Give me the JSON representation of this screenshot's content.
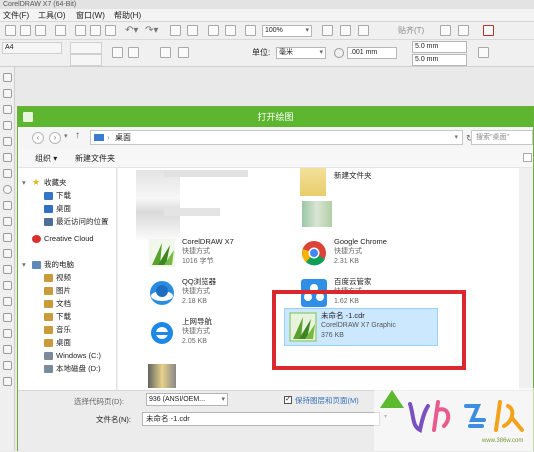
{
  "app": {
    "title": "CorelDRAW X7 (64-Bit)",
    "menu": [
      "文件(F)",
      "工具(O)",
      "窗口(W)",
      "帮助(H)"
    ],
    "zoom": "100%",
    "align_label": "贴齐(T)",
    "paper_size": "A4",
    "unit_label": "单位:",
    "unit_value": "毫米",
    "nudge_value": ".001 mm",
    "dup_x": "5.0 mm",
    "dup_y": "5.0 mm"
  },
  "dialog": {
    "title": "打开绘图",
    "path": "桌面",
    "search_placeholder": "搜索\"桌面\"",
    "organize_label": "组织 ▾",
    "new_folder_label": "新建文件夹",
    "nav": {
      "favorites": "收藏夹",
      "items_fav": [
        "下载",
        "桌面",
        "最近访问的位置"
      ],
      "creative_cloud": "Creative Cloud",
      "computer": "我的电脑",
      "items_pc": [
        "视频",
        "图片",
        "文档",
        "下载",
        "音乐",
        "桌面",
        "Windows (C:)",
        "本地磁盘 (D:)"
      ]
    },
    "files": [
      {
        "name": "新建文件夹",
        "type": "",
        "size": ""
      },
      {
        "name": "CorelDRAW X7",
        "type": "快捷方式",
        "size": "1016 字节"
      },
      {
        "name": "Google Chrome",
        "type": "快捷方式",
        "size": "2.31 KB"
      },
      {
        "name": "QQ浏览器",
        "type": "快捷方式",
        "size": "2.18 KB"
      },
      {
        "name": "百度云管家",
        "type": "快捷方式",
        "size": "1.62 KB"
      },
      {
        "name": "上网导航",
        "type": "快捷方式",
        "size": "2.05 KB"
      },
      {
        "name": "未命名 -1.cdr",
        "type": "CorelDRAW X7 Graphic",
        "size": "376 KB"
      }
    ],
    "codepage_label": "选择代码页(D):",
    "codepage_value": "936  (ANSI/OEM...",
    "keep_layers_label": "保持图层和页面(M)",
    "filename_label": "文件名(N):",
    "filename_value": "未命名 -1.cdr"
  },
  "colors": {
    "dialog_accent": "#5db530",
    "highlight_box": "#d9282e",
    "selected_bg": "#cce8ff"
  },
  "watermark": "www.386w.com"
}
